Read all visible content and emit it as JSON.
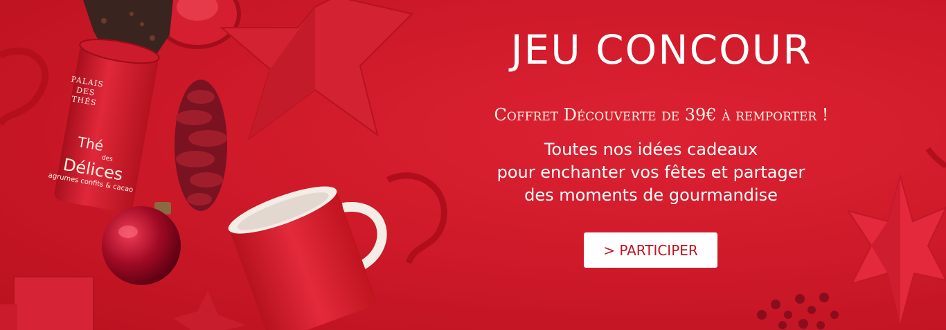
{
  "banner": {
    "title": "JEU CONCOUR",
    "subtitle": "Coffret Découverte de 39€ à remporter !",
    "body_lines": [
      "Toutes nos idées cadeaux",
      "pour enchanter vos fêtes et partager",
      "des moments de gourmandise"
    ],
    "cta_label": "> PARTICIPER"
  },
  "product": {
    "brand": "PALAIS DES THÉS",
    "name_line1": "Thé",
    "name_small": "des",
    "name_line2": "Délices",
    "descriptor": "agrumes confits & cacao"
  },
  "colors": {
    "background": "#d11a2a",
    "text": "#ffffff",
    "cta_background": "#ffffff",
    "cta_text": "#c1121f"
  }
}
